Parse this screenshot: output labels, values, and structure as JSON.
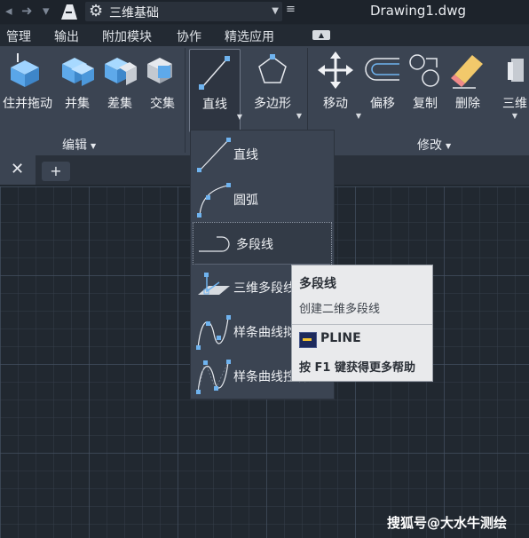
{
  "app": {
    "workspace": "三维基础",
    "document_title": "Drawing1.dwg"
  },
  "menu": [
    "管理",
    "输出",
    "附加模块",
    "协作",
    "精选应用"
  ],
  "ribbon": {
    "edit_tools": [
      "住并拖动",
      "并集",
      "差集",
      "交集"
    ],
    "draw_tools": [
      "直线",
      "多边形"
    ],
    "modify_tools": [
      "移动",
      "偏移",
      "复制",
      "删除",
      "三维"
    ],
    "panels": [
      "编辑",
      "修改"
    ]
  },
  "dropdown": {
    "items": [
      "直线",
      "圆弧",
      "多段线",
      "三维多段线",
      "样条曲线拟合",
      "样条曲线控制点"
    ]
  },
  "tooltip": {
    "title": "多段线",
    "description": "创建二维多段线",
    "command": "PLINE",
    "help": "按 F1 键获得更多帮助"
  },
  "watermark": "搜狐号@大水牛测绘",
  "colors": {
    "ribbon_bg": "#3b4452",
    "canvas_bg": "#212830",
    "tooltip_bg": "#e9eaec",
    "accent_blue": "#6fb3ef"
  }
}
